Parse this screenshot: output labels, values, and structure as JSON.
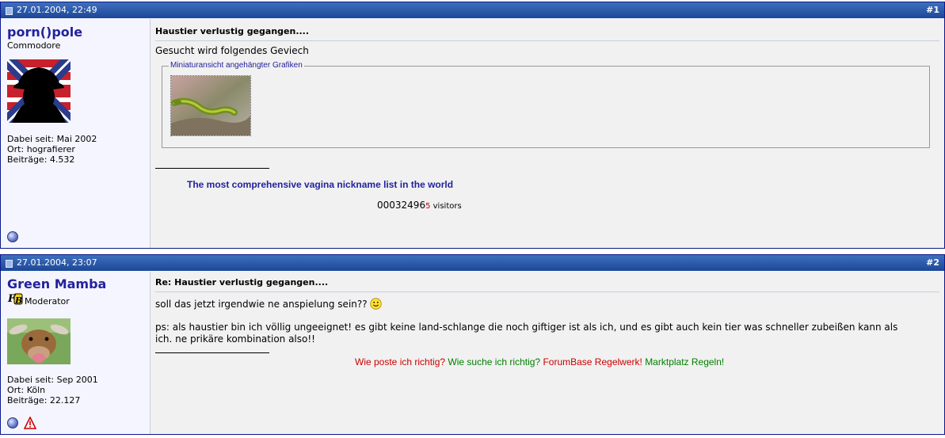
{
  "posts": [
    {
      "date": "27.01.2004, 22:49",
      "number": "#1",
      "user": {
        "name": "porn()pole",
        "title": "Commodore",
        "joined": "Dabei seit: Mai 2002",
        "location": "Ort: hografierer",
        "posts": "Beiträge: 4.532",
        "avatar_icon": "silhouette-flag-avatar"
      },
      "title": "Haustier verlustig gegangen....",
      "body": "Gesucht wird folgendes Geviech",
      "attachments_legend": "Miniaturansicht angehängter Grafiken",
      "signature_link": "The most comprehensive vagina nickname list in the world",
      "counter_digits": "00032496",
      "counter_last": "5",
      "counter_suffix": " visitors"
    },
    {
      "date": "27.01.2004, 23:07",
      "number": "#2",
      "user": {
        "name": "Green Mamba",
        "title": "Moderator",
        "joined": "Dabei seit: Sep 2001",
        "location": "Ort: Köln",
        "posts": "Beiträge: 22.127",
        "avatar_icon": "cow-avatar",
        "badge": "FB"
      },
      "title": "Re: Haustier verlustig gegangen....",
      "body_line1": "soll das jetzt irgendwie ne anspielung sein??",
      "body_line2": "ps: als haustier bin ich völlig ungeeignet! es gibt keine land-schlange die noch giftiger ist als ich, und es gibt auch kein tier was schneller zubeißen kann als",
      "body_line3": "ich. ne prikäre kombination also!!",
      "sig_links": [
        {
          "label": "Wie poste ich richtig?",
          "color": "#cc0000"
        },
        {
          "label": "Wie suche ich richtig?",
          "color": "#008000"
        },
        {
          "label": "ForumBase Regelwerk!",
          "color": "#cc0000"
        },
        {
          "label": "Marktplatz Regeln!",
          "color": "#008000"
        }
      ]
    }
  ],
  "colors": {
    "header": "#1c4798",
    "username": "#22229c",
    "border": "#0b198c"
  }
}
